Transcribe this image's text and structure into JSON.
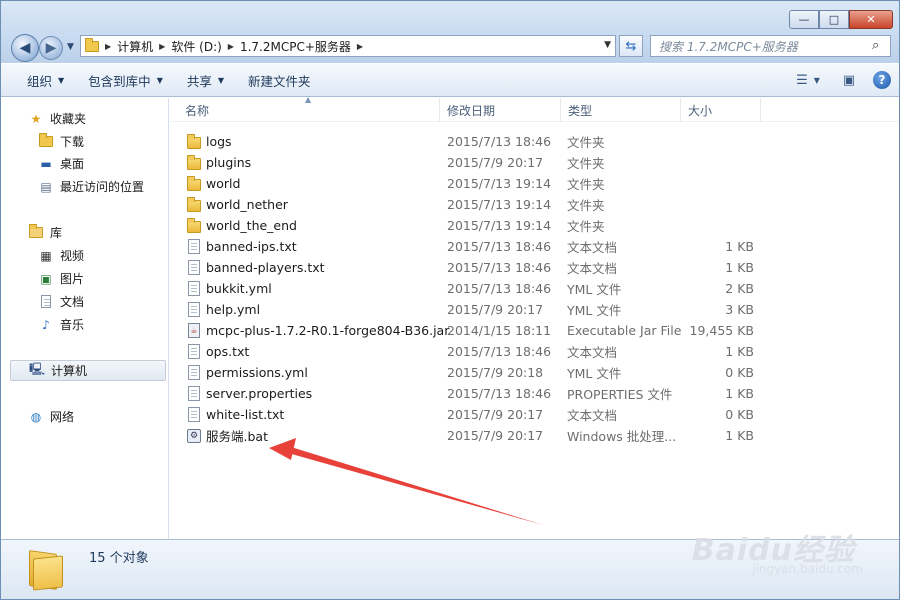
{
  "window": {
    "min_label": "—",
    "max_label": "□",
    "close_label": "✕"
  },
  "address": {
    "crumbs": [
      "计算机",
      "软件 (D:)",
      "1.7.2MCPC+服务器"
    ]
  },
  "search": {
    "placeholder": "搜索 1.7.2MCPC+服务器"
  },
  "toolbar": {
    "organize": "组织",
    "include_library": "包含到库中",
    "share": "共享",
    "new_folder": "新建文件夹"
  },
  "sidebar": {
    "favorites": "收藏夹",
    "downloads": "下载",
    "desktop": "桌面",
    "recent": "最近访问的位置",
    "libraries": "库",
    "videos": "视频",
    "pictures": "图片",
    "documents": "文档",
    "music": "音乐",
    "computer": "计算机",
    "network": "网络"
  },
  "columns": {
    "name": "名称",
    "date": "修改日期",
    "type": "类型",
    "size": "大小"
  },
  "files": [
    {
      "name": "logs",
      "date": "2015/7/13 18:46",
      "type": "文件夹",
      "size": "",
      "icon": "folder"
    },
    {
      "name": "plugins",
      "date": "2015/7/9 20:17",
      "type": "文件夹",
      "size": "",
      "icon": "folder"
    },
    {
      "name": "world",
      "date": "2015/7/13 19:14",
      "type": "文件夹",
      "size": "",
      "icon": "folder"
    },
    {
      "name": "world_nether",
      "date": "2015/7/13 19:14",
      "type": "文件夹",
      "size": "",
      "icon": "folder"
    },
    {
      "name": "world_the_end",
      "date": "2015/7/13 19:14",
      "type": "文件夹",
      "size": "",
      "icon": "folder"
    },
    {
      "name": "banned-ips.txt",
      "date": "2015/7/13 18:46",
      "type": "文本文档",
      "size": "1 KB",
      "icon": "document"
    },
    {
      "name": "banned-players.txt",
      "date": "2015/7/13 18:46",
      "type": "文本文档",
      "size": "1 KB",
      "icon": "document"
    },
    {
      "name": "bukkit.yml",
      "date": "2015/7/13 18:46",
      "type": "YML 文件",
      "size": "2 KB",
      "icon": "document"
    },
    {
      "name": "help.yml",
      "date": "2015/7/9 20:17",
      "type": "YML 文件",
      "size": "3 KB",
      "icon": "document"
    },
    {
      "name": "mcpc-plus-1.7.2-R0.1-forge804-B36.jar",
      "date": "2014/1/15 18:11",
      "type": "Executable Jar File",
      "size": "19,455 KB",
      "icon": "jar"
    },
    {
      "name": "ops.txt",
      "date": "2015/7/13 18:46",
      "type": "文本文档",
      "size": "1 KB",
      "icon": "document"
    },
    {
      "name": "permissions.yml",
      "date": "2015/7/9 20:18",
      "type": "YML 文件",
      "size": "0 KB",
      "icon": "document"
    },
    {
      "name": "server.properties",
      "date": "2015/7/13 18:46",
      "type": "PROPERTIES 文件",
      "size": "1 KB",
      "icon": "document"
    },
    {
      "name": "white-list.txt",
      "date": "2015/7/9 20:17",
      "type": "文本文档",
      "size": "0 KB",
      "icon": "document"
    },
    {
      "name": "服务端.bat",
      "date": "2015/7/9 20:17",
      "type": "Windows 批处理...",
      "size": "1 KB",
      "icon": "batch"
    }
  ],
  "status": {
    "count": "15 个对象"
  },
  "annotation": {
    "arrow_color": "#e8413a"
  },
  "watermark": {
    "brand": "Baidu经验",
    "url": "jingyan.baidu.com"
  }
}
